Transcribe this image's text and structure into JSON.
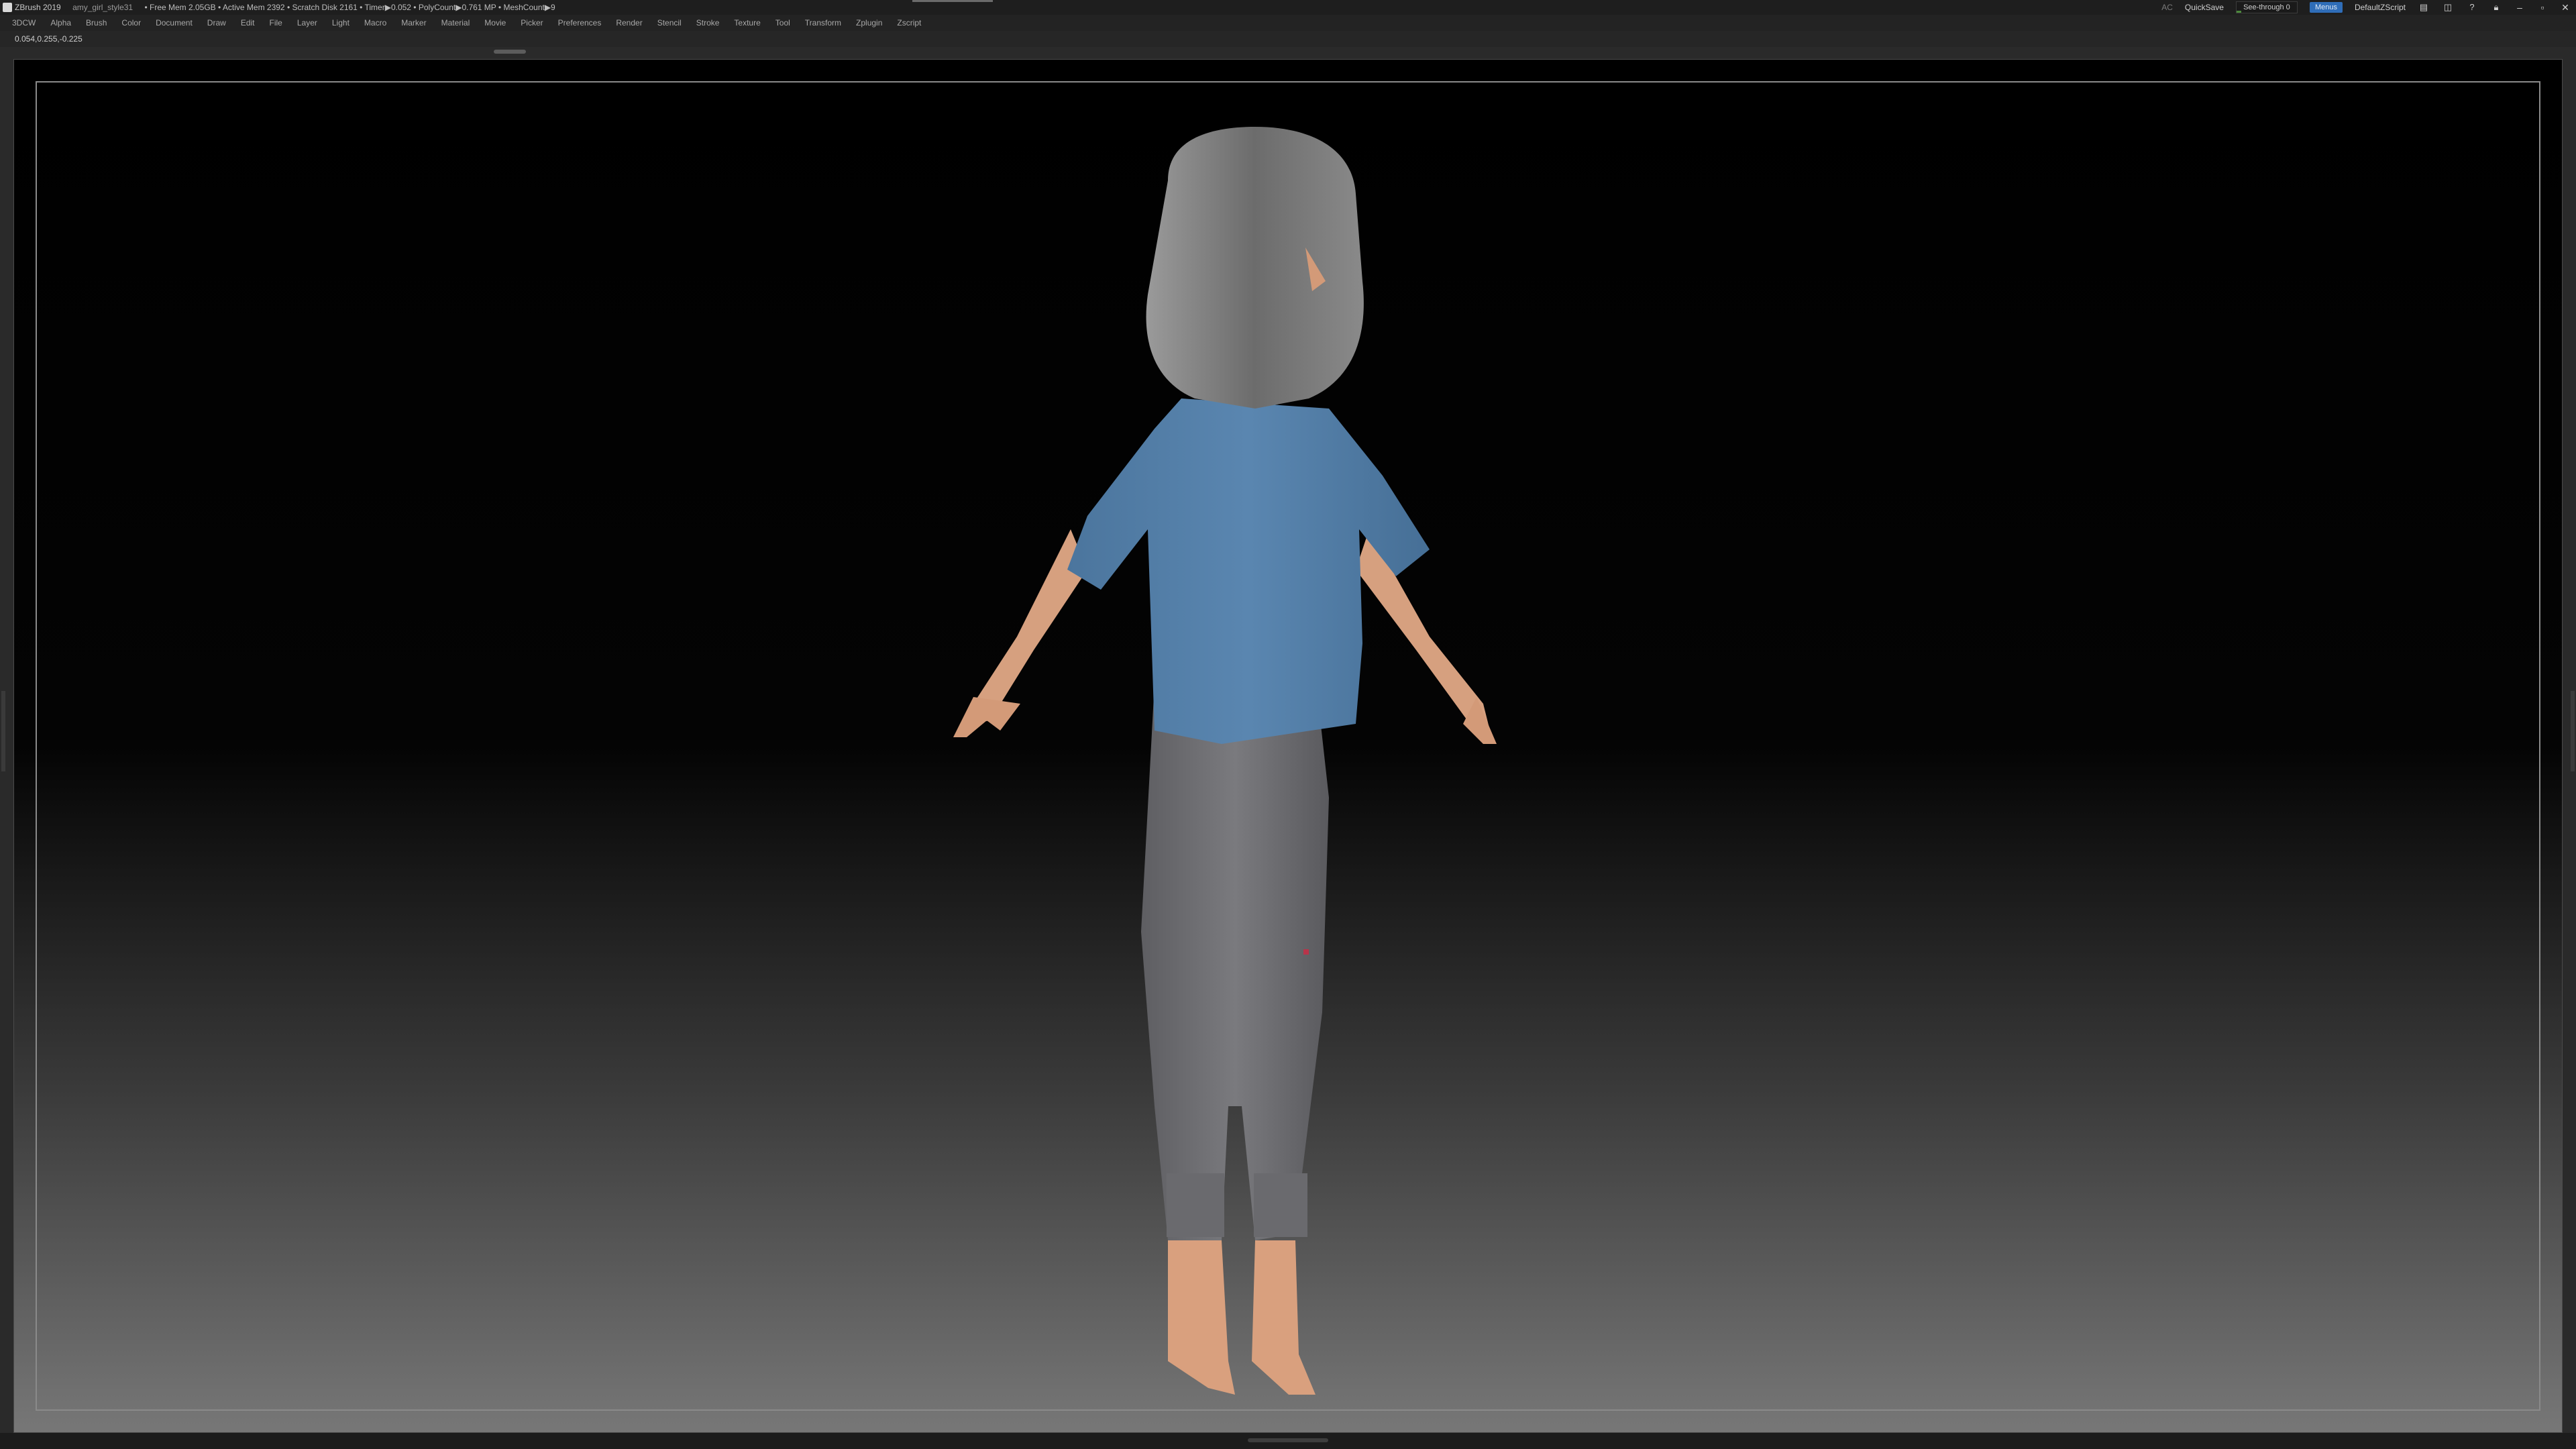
{
  "title_bar": {
    "app_name": "ZBrush 2019",
    "document_name": "amy_girl_style31",
    "stats": "• Free Mem 2.05GB • Active Mem 2392 • Scratch Disk 2161 • Timer▶0.052 • PolyCount▶0.761 MP • MeshCount▶9",
    "ac": "AC",
    "quicksave": "QuickSave",
    "see_through_label": "See-through 0",
    "see_through_value": 0.08,
    "menus_label": "Menus",
    "script_label": "DefaultZScript"
  },
  "menu_bar": {
    "items": [
      "3DCW",
      "Alpha",
      "Brush",
      "Color",
      "Document",
      "Draw",
      "Edit",
      "File",
      "Layer",
      "Light",
      "Macro",
      "Marker",
      "Material",
      "Movie",
      "Picker",
      "Preferences",
      "Render",
      "Stencil",
      "Stroke",
      "Texture",
      "Tool",
      "Transform",
      "Zplugin",
      "Zscript"
    ]
  },
  "status": {
    "coordinates": "0.054,0.255,-0.225"
  },
  "colors": {
    "accent": "#2f6db8",
    "shirt": "#4f7aa3",
    "pants": "#6f6f72",
    "skin": "#d9a07e",
    "hair": "#7c7c7c"
  }
}
